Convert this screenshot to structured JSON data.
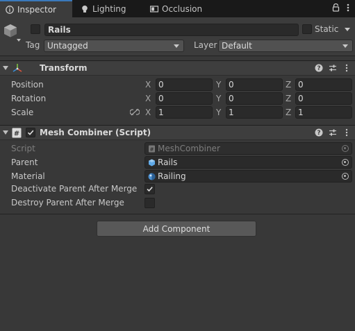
{
  "tabs": [
    {
      "label": "Inspector",
      "icon": "info-icon",
      "active": true
    },
    {
      "label": "Lighting",
      "icon": "lightbulb-icon",
      "active": false
    },
    {
      "label": "Occlusion",
      "icon": "occlusion-icon",
      "active": false
    }
  ],
  "object": {
    "name": "Rails",
    "static_label": "Static",
    "tag_label": "Tag",
    "tag_value": "Untagged",
    "layer_label": "Layer",
    "layer_value": "Default"
  },
  "transform": {
    "title": "Transform",
    "position": {
      "label": "Position",
      "x": "0",
      "y": "0",
      "z": "0"
    },
    "rotation": {
      "label": "Rotation",
      "x": "0",
      "y": "0",
      "z": "0"
    },
    "scale": {
      "label": "Scale",
      "x": "1",
      "y": "1",
      "z": "1"
    },
    "axes": {
      "x": "X",
      "y": "Y",
      "z": "Z"
    }
  },
  "mesh_combiner": {
    "title": "Mesh Combiner (Script)",
    "script_label": "Script",
    "script_value": "MeshCombiner",
    "parent_label": "Parent",
    "parent_value": "Rails",
    "material_label": "Material",
    "material_value": "Railing",
    "deactivate_label": "Deactivate Parent After Merge",
    "deactivate_checked": true,
    "destroy_label": "Destroy Parent After Merge",
    "destroy_checked": false
  },
  "add_component_label": "Add Component",
  "colors": {
    "accent": "#3a79bb",
    "background": "#383838",
    "tabbar": "#191919"
  }
}
